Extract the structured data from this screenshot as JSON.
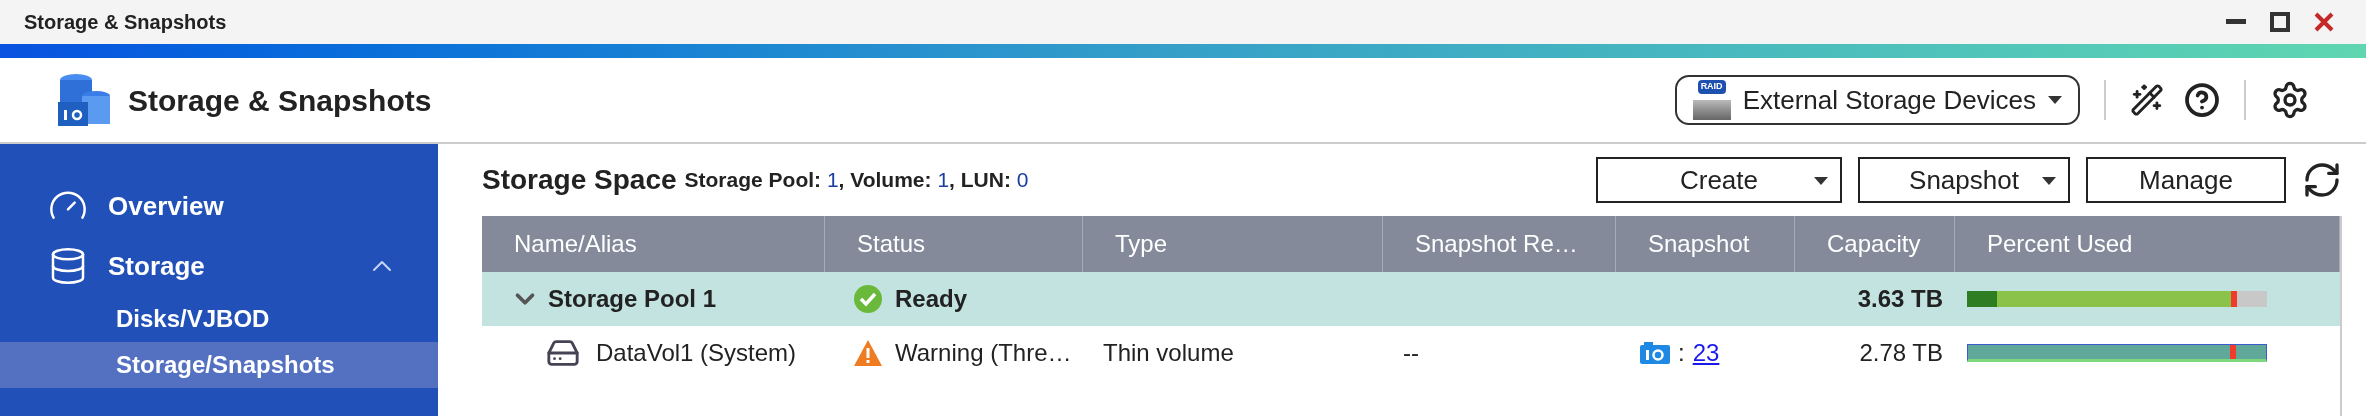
{
  "window": {
    "title": "Storage & Snapshots"
  },
  "header": {
    "app_title": "Storage & Snapshots",
    "external_button": "External Storage Devices",
    "raid_badge": "RAID"
  },
  "sidebar": {
    "items": [
      {
        "label": "Overview",
        "selected": false
      },
      {
        "label": "Storage",
        "selected": false,
        "expanded": true,
        "children": [
          {
            "label": "Disks/VJBOD",
            "selected": false
          },
          {
            "label": "Storage/Snapshots",
            "selected": true
          }
        ]
      }
    ]
  },
  "storage_space": {
    "title": "Storage Space",
    "summary": [
      {
        "label": "Storage Pool:",
        "value": "1"
      },
      {
        "label": ", Volume:",
        "value": "1"
      },
      {
        "label": ", LUN:",
        "value": "0"
      }
    ]
  },
  "toolbar": {
    "buttons": [
      {
        "label": "Create",
        "dropdown": true
      },
      {
        "label": "Snapshot",
        "dropdown": true
      },
      {
        "label": "Manage",
        "dropdown": false
      }
    ]
  },
  "table": {
    "columns": [
      "Name/Alias",
      "Status",
      "Type",
      "Snapshot Re…",
      "Snapshot",
      "Capacity",
      "Percent Used"
    ],
    "rows": [
      {
        "kind": "pool",
        "name": "Storage Pool 1",
        "expanded": true,
        "status": "Ready",
        "warning": false,
        "capacity": "3.63 TB"
      },
      {
        "kind": "volume",
        "name": "DataVol1 (System)",
        "status": "Warning (Thre…",
        "warning": true,
        "type": "Thin volume",
        "snapshot_reserve": "--",
        "snapshot_count": "23",
        "snapshot_sep": ":",
        "capacity": "2.78 TB"
      }
    ]
  }
}
